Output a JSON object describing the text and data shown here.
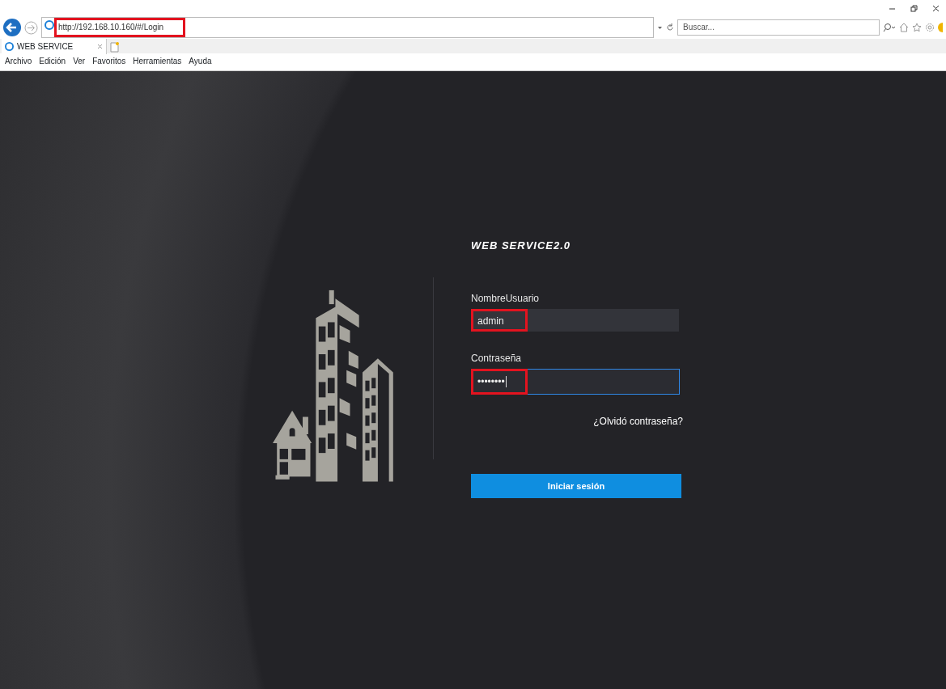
{
  "browser": {
    "address": {
      "url": "http://192.168.10.160/#/Login",
      "highlighted": true
    },
    "search": {
      "placeholder": "Buscar..."
    },
    "tabs": [
      {
        "title": "WEB SERVICE",
        "selected": true
      }
    ],
    "menu": [
      "Archivo",
      "Edición",
      "Ver",
      "Favoritos",
      "Herramientas",
      "Ayuda"
    ]
  },
  "login": {
    "title": "WEB SERVICE2.0",
    "fields": [
      {
        "label": "NombreUsuario",
        "value": "admin",
        "kind": "text",
        "focused": false,
        "highlighted": true
      },
      {
        "label": "Contraseña",
        "value": "••••••••",
        "kind": "password",
        "focused": true,
        "highlighted": true
      }
    ],
    "forgot_link": "¿Olvidó contraseña?",
    "submit": "Iniciar sesión"
  }
}
